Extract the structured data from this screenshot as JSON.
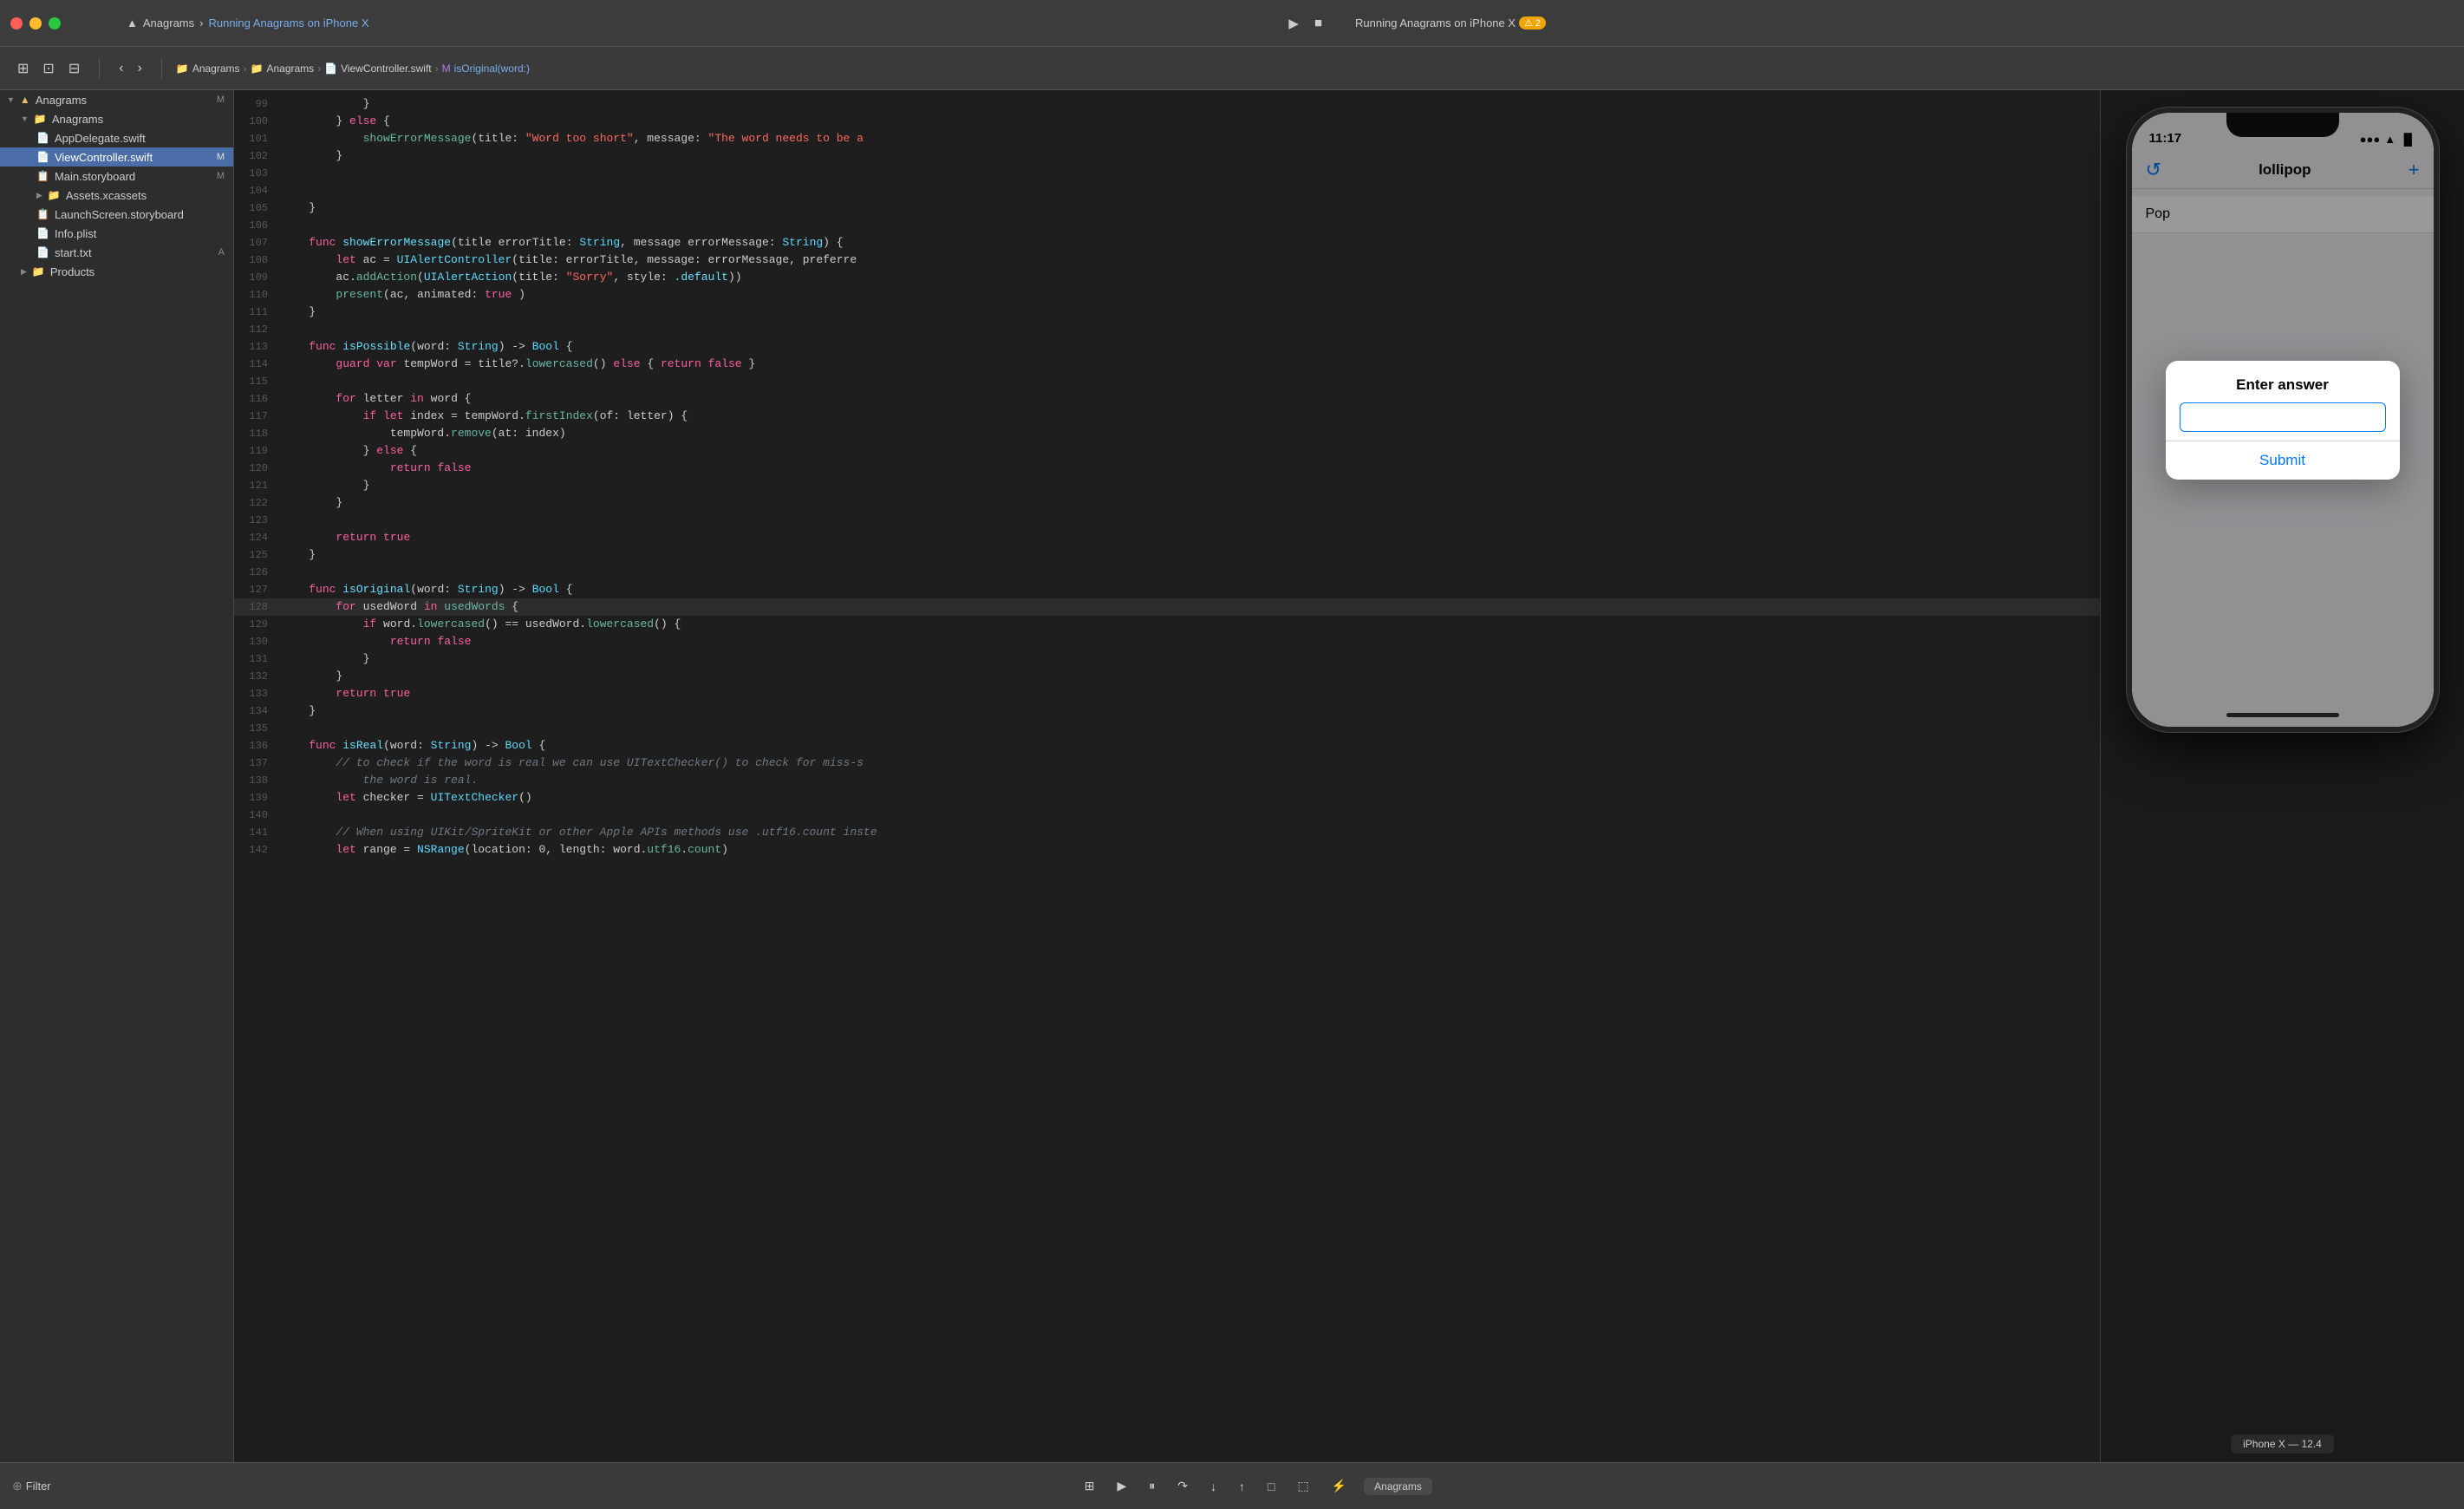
{
  "window": {
    "title": "Running Anagrams on iPhone X",
    "tab_label": "Running Anagrams on iPhone X",
    "warning_count": "2",
    "traffic_lights": [
      "close",
      "minimize",
      "maximize"
    ]
  },
  "toolbar": {
    "back_label": "‹",
    "forward_label": "›",
    "breadcrumb": [
      "Anagrams",
      "Anagrams",
      "ViewController.swift",
      "isOriginal(word:)"
    ],
    "breadcrumb_icons": [
      "folder-blue",
      "folder-yellow",
      "swift-file",
      "func-icon"
    ]
  },
  "sidebar": {
    "items": [
      {
        "label": "Anagrams",
        "icon": "▲",
        "level": 0,
        "badge": "M",
        "expanded": true
      },
      {
        "label": "Anagrams",
        "icon": "📁",
        "level": 1,
        "badge": "",
        "expanded": true
      },
      {
        "label": "AppDelegate.swift",
        "icon": "📄",
        "level": 2,
        "badge": ""
      },
      {
        "label": "ViewController.swift",
        "icon": "📄",
        "level": 2,
        "badge": "M",
        "selected": true
      },
      {
        "label": "Main.storyboard",
        "icon": "📋",
        "level": 2,
        "badge": "M"
      },
      {
        "label": "Assets.xcassets",
        "icon": "📁",
        "level": 2,
        "badge": ""
      },
      {
        "label": "LaunchScreen.storyboard",
        "icon": "📋",
        "level": 2,
        "badge": ""
      },
      {
        "label": "Info.plist",
        "icon": "📄",
        "level": 2,
        "badge": ""
      },
      {
        "label": "start.txt",
        "icon": "📄",
        "level": 2,
        "badge": "A"
      },
      {
        "label": "Products",
        "icon": "📁",
        "level": 1,
        "badge": "",
        "expanded": false
      }
    ]
  },
  "code": {
    "lines": [
      {
        "num": 99,
        "content": "            }"
      },
      {
        "num": 100,
        "content": "        } else {",
        "tokens": [
          {
            "t": "kw",
            "v": "else"
          }
        ]
      },
      {
        "num": 101,
        "content": "            showErrorMessage(title: \"Word too short\", message: \"The word needs to be a",
        "tokens": []
      },
      {
        "num": 102,
        "content": "        }"
      },
      {
        "num": 103,
        "content": ""
      },
      {
        "num": 104,
        "content": ""
      },
      {
        "num": 105,
        "content": "    }"
      },
      {
        "num": 106,
        "content": ""
      },
      {
        "num": 107,
        "content": "    func showErrorMessage(title errorTitle: String, message errorMessage: String) {",
        "tokens": []
      },
      {
        "num": 108,
        "content": "        let ac = UIAlertController(title: errorTitle, message: errorMessage, preferre",
        "tokens": []
      },
      {
        "num": 109,
        "content": "        ac.addAction(UIAlertAction(title: \"Sorry\", style: .default))",
        "tokens": []
      },
      {
        "num": 110,
        "content": "        present(ac, animated: true )"
      },
      {
        "num": 111,
        "content": "    }"
      },
      {
        "num": 112,
        "content": ""
      },
      {
        "num": 113,
        "content": "    func isPossible(word: String) -> Bool {",
        "tokens": []
      },
      {
        "num": 114,
        "content": "        guard var tempWord = title?.lowercased() else { return false }",
        "tokens": []
      },
      {
        "num": 115,
        "content": ""
      },
      {
        "num": 116,
        "content": "        for letter in word {",
        "tokens": []
      },
      {
        "num": 117,
        "content": "            if let index = tempWord.firstIndex(of: letter) {",
        "tokens": []
      },
      {
        "num": 118,
        "content": "                tempWord.remove(at: index)"
      },
      {
        "num": 119,
        "content": "            } else {",
        "tokens": []
      },
      {
        "num": 120,
        "content": "                return false"
      },
      {
        "num": 121,
        "content": "            }"
      },
      {
        "num": 122,
        "content": "        }"
      },
      {
        "num": 123,
        "content": ""
      },
      {
        "num": 124,
        "content": "        return true"
      },
      {
        "num": 125,
        "content": "    }"
      },
      {
        "num": 126,
        "content": ""
      },
      {
        "num": 127,
        "content": "    func isOriginal(word: String) -> Bool {",
        "tokens": []
      },
      {
        "num": 128,
        "content": "        for usedWord in usedWords {",
        "tokens": [],
        "highlighted": true
      },
      {
        "num": 129,
        "content": "            if word.lowercased() == usedWord.lowercased() {",
        "tokens": []
      },
      {
        "num": 130,
        "content": "                return false"
      },
      {
        "num": 131,
        "content": "            }"
      },
      {
        "num": 132,
        "content": "        }"
      },
      {
        "num": 133,
        "content": "        return true"
      },
      {
        "num": 134,
        "content": "    }"
      },
      {
        "num": 135,
        "content": ""
      },
      {
        "num": 136,
        "content": "    func isReal(word: String) -> Bool {",
        "tokens": []
      },
      {
        "num": 137,
        "content": "        // to check if the word is real we can use UITextChecker() to check for miss-s"
      },
      {
        "num": 138,
        "content": "            the word is real."
      },
      {
        "num": 139,
        "content": "        let checker = UITextChecker()"
      },
      {
        "num": 140,
        "content": ""
      },
      {
        "num": 141,
        "content": "        // When using UIKit/SpriteKit or other Apple APIs methods use .utf16.count inste"
      },
      {
        "num": 142,
        "content": "        let range = NSRange(location: 0, length: word.utf16.count)"
      }
    ]
  },
  "iphone": {
    "status_time": "11:17",
    "nav_title": "lollipop",
    "list_items": [
      "Pop"
    ],
    "alert_title": "Enter answer",
    "alert_input_placeholder": "",
    "alert_submit": "Submit",
    "device_label": "iPhone X — 12.4"
  },
  "bottom_bar": {
    "filter_label": "Filter",
    "scheme_label": "Anagrams"
  }
}
